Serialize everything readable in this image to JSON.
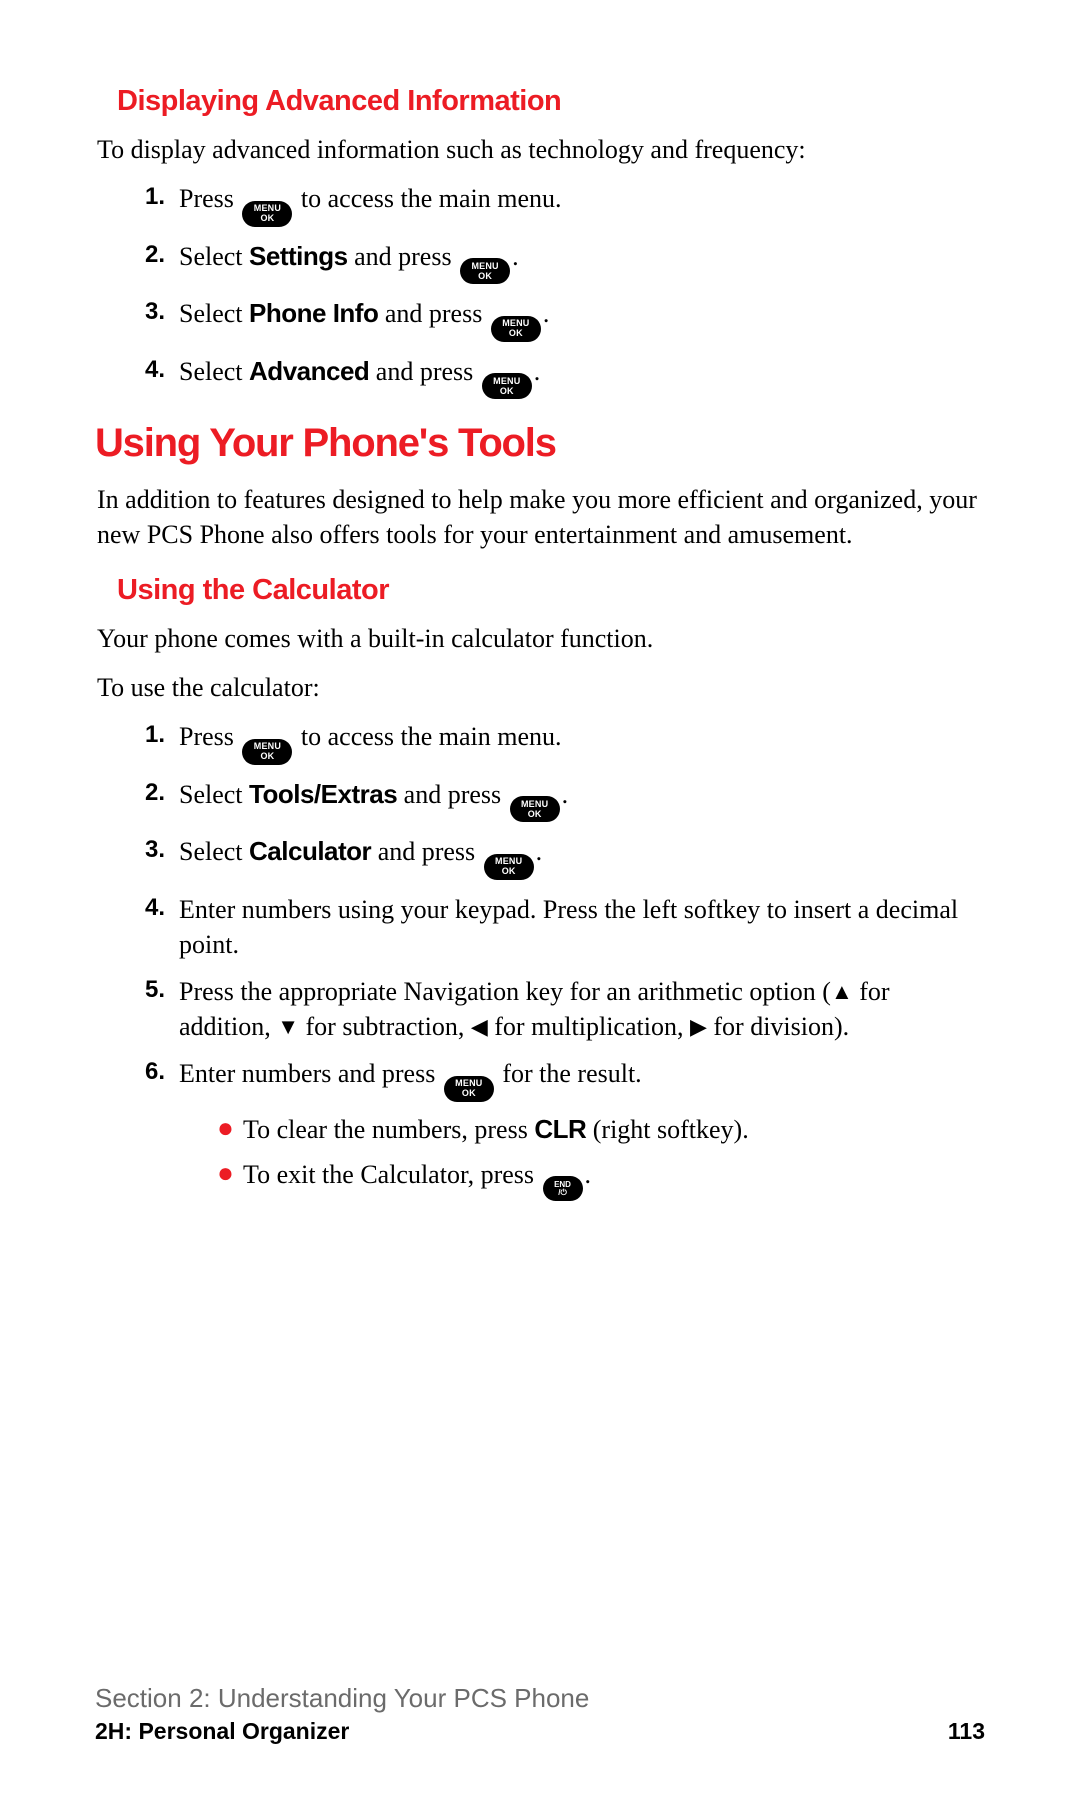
{
  "headings": {
    "sub1": "Displaying Advanced Information",
    "main": "Using Your Phone's Tools",
    "sub2": "Using the Calculator"
  },
  "body": {
    "intro1": "To display advanced information such as technology and frequency:",
    "intro_main": "In addition to features designed to help make you more efficient and organized, your new PCS Phone also offers tools for your entertainment and amusement.",
    "calc_intro1": "Your phone comes with a built-in calculator function.",
    "calc_intro2": "To use the calculator:"
  },
  "pill": {
    "menu_top": "MENU",
    "menu_bottom": "OK",
    "end_top": "END",
    "end_bottom": "/⏻"
  },
  "list1": {
    "n1": "1.",
    "t1a": "Press ",
    "t1b": " to access the main menu.",
    "n2": "2.",
    "t2a": "Select ",
    "t2b": "Settings",
    "t2c": " and press ",
    "t2d": ".",
    "n3": "3.",
    "t3a": "Select ",
    "t3b": "Phone Info",
    "t3c": " and press ",
    "t3d": ".",
    "n4": "4.",
    "t4a": "Select ",
    "t4b": "Advanced",
    "t4c": " and press ",
    "t4d": "."
  },
  "list2": {
    "n1": "1.",
    "t1a": "Press ",
    "t1b": " to access the main menu.",
    "n2": "2.",
    "t2a": "Select ",
    "t2b": "Tools/Extras",
    "t2c": " and press ",
    "t2d": ".",
    "n3": "3.",
    "t3a": "Select ",
    "t3b": "Calculator",
    "t3c": " and press ",
    "t3d": ".",
    "n4": "4.",
    "t4": "Enter numbers using your keypad. Press the left softkey to insert a decimal point.",
    "n5": "5.",
    "t5a": "Press the appropriate Navigation key for an arithmetic option (",
    "t5b": " for addition, ",
    "t5c": " for subtraction, ",
    "t5d": " for multiplication, ",
    "t5e": " for division).",
    "n6": "6.",
    "t6a": "Enter numbers and press ",
    "t6b": " for the result.",
    "sub1a": "To clear the numbers, press ",
    "sub1b": "CLR",
    "sub1c": " (right softkey).",
    "sub2a": "To exit the Calculator, press ",
    "sub2b": "."
  },
  "footer": {
    "line1": "Section 2: Understanding Your PCS Phone",
    "line2": "2H: Personal Organizer",
    "page": "113"
  }
}
